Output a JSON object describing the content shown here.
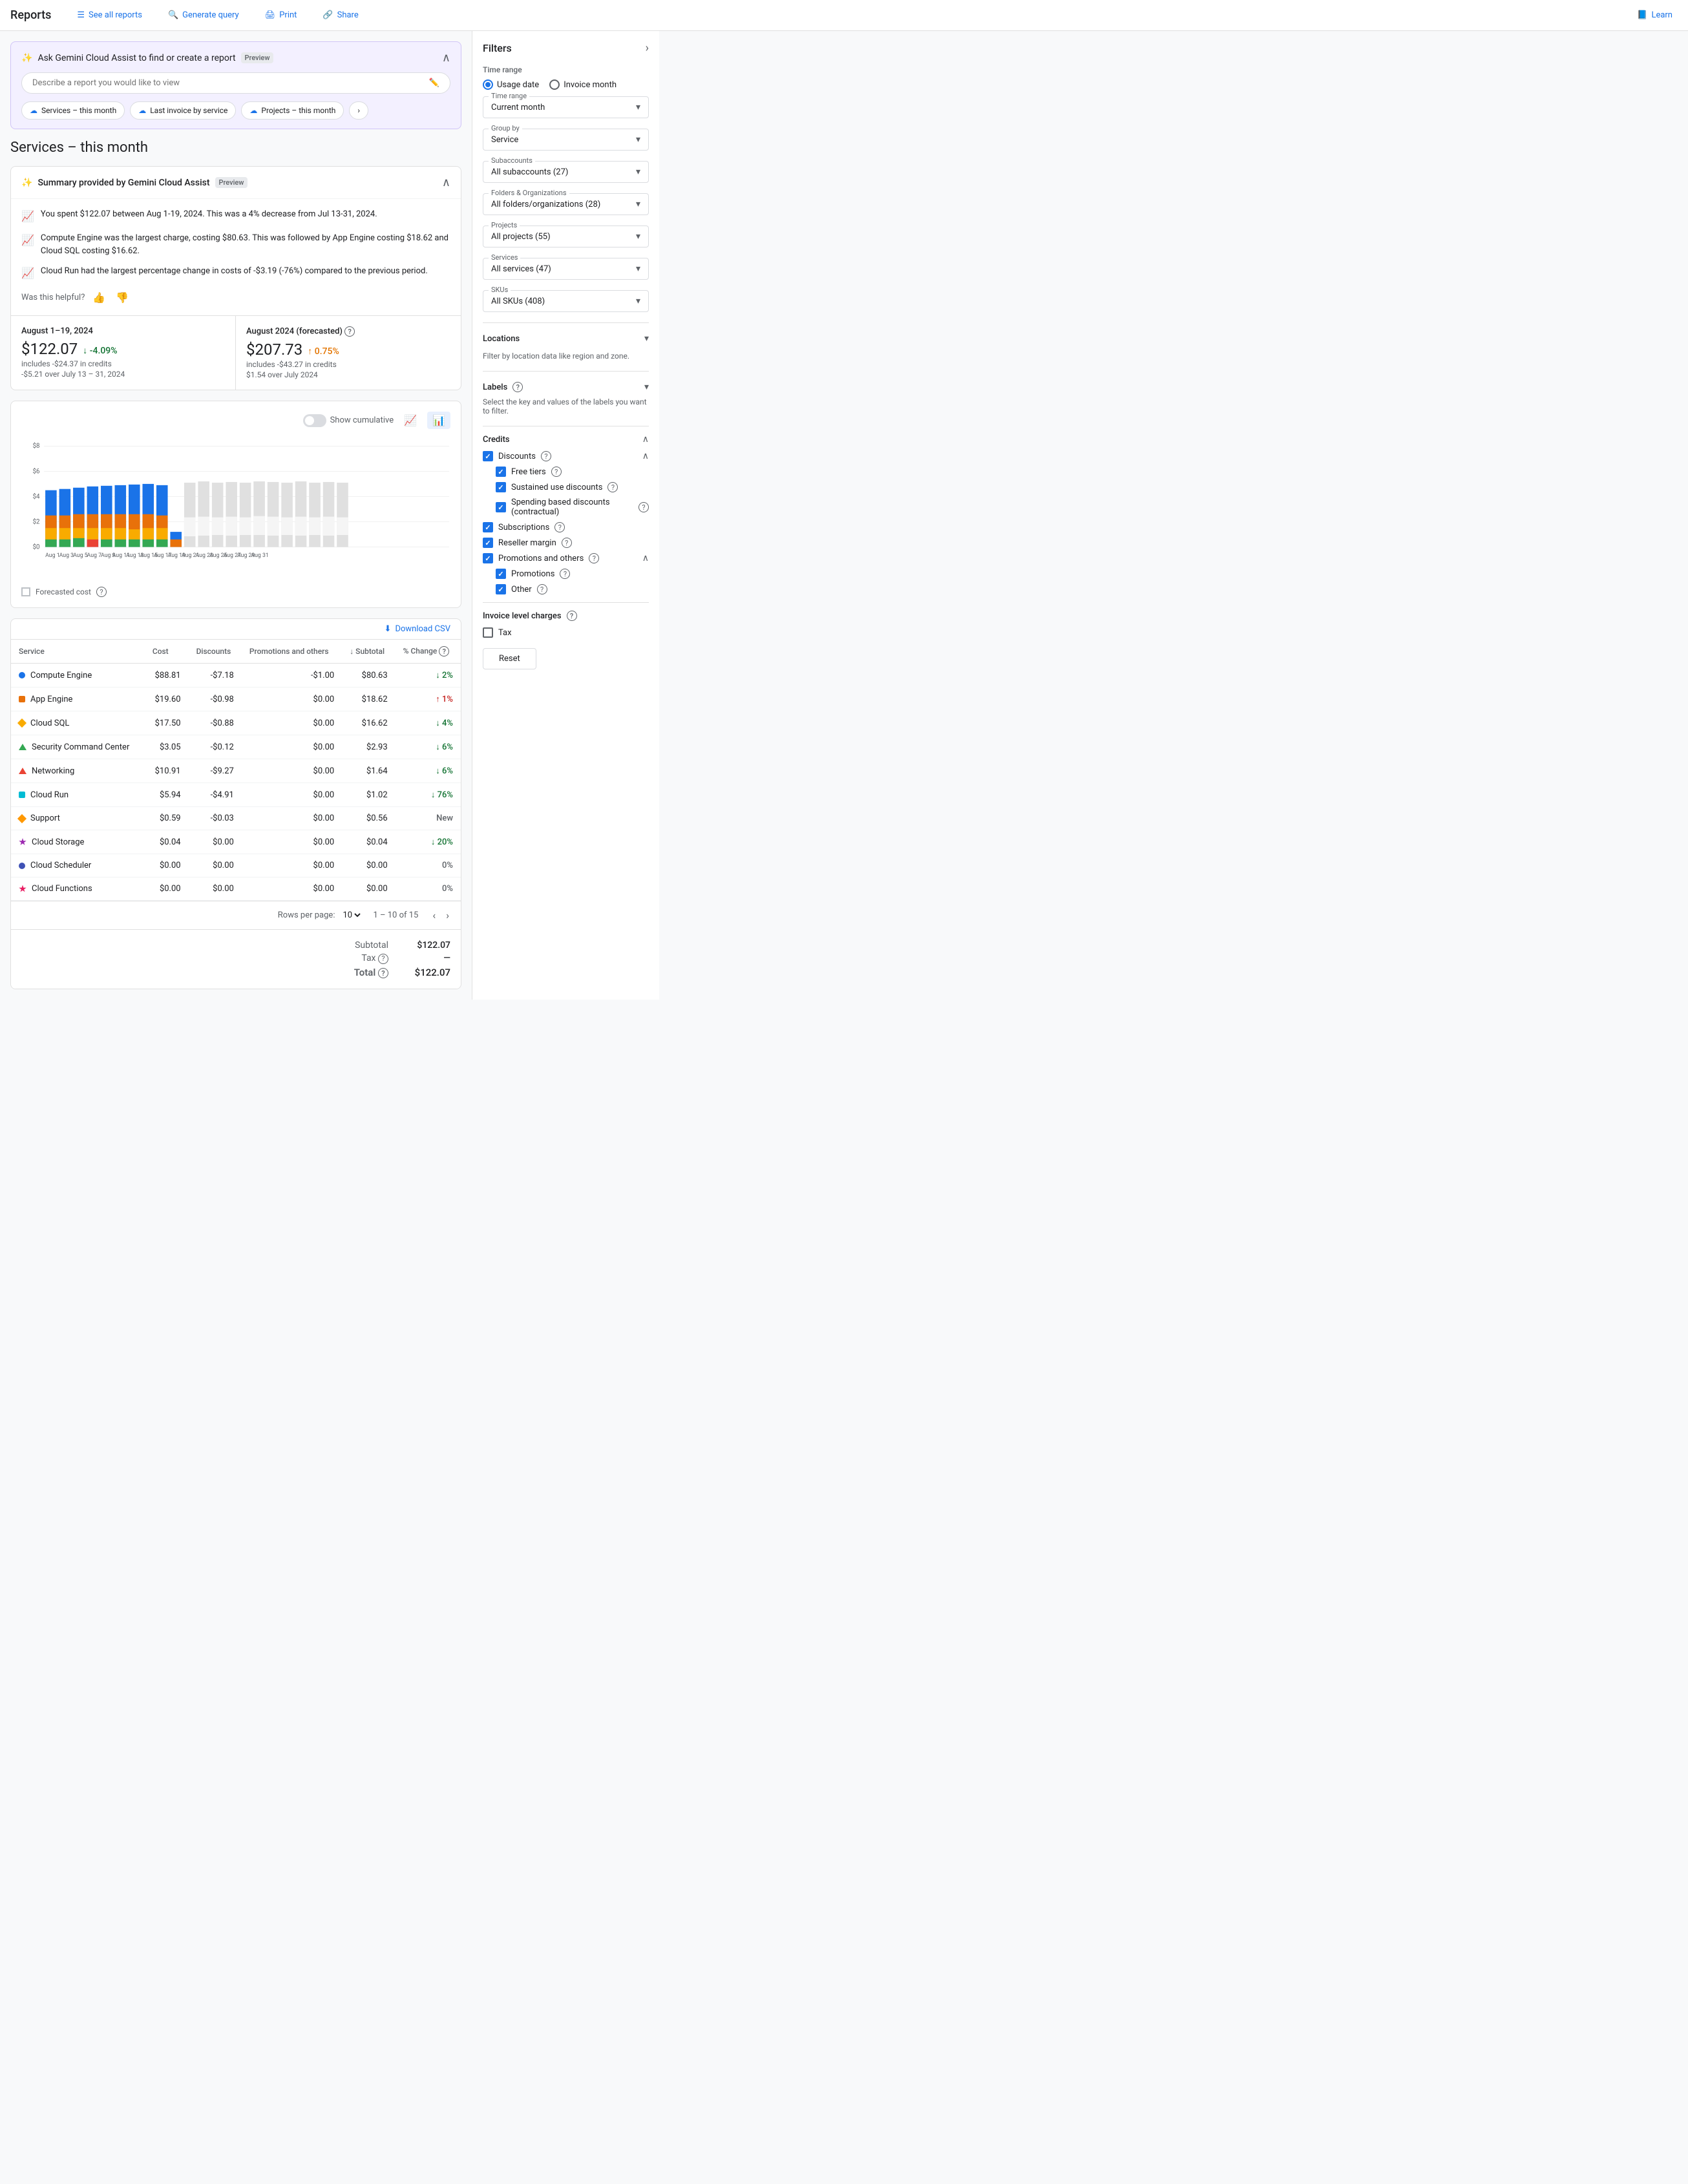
{
  "nav": {
    "title": "Reports",
    "items": [
      {
        "label": "See all reports",
        "icon": "☰"
      },
      {
        "label": "Generate query",
        "icon": "🔍"
      },
      {
        "label": "Print",
        "icon": "🖨"
      },
      {
        "label": "Share",
        "icon": "🔗"
      },
      {
        "label": "Learn",
        "icon": "📘"
      }
    ]
  },
  "gemini": {
    "title": "Ask Gemini Cloud Assist to find or create a report",
    "badge": "Preview",
    "placeholder": "Describe a report you would like to view",
    "chips": [
      {
        "label": "Services – this month"
      },
      {
        "label": "Last invoice by service"
      },
      {
        "label": "Projects – this month"
      }
    ]
  },
  "page_title": "Services – this month",
  "summary": {
    "title": "Summary provided by Gemini Cloud Assist",
    "badge": "Preview",
    "items": [
      {
        "text": "You spent $122.07 between Aug 1-19, 2024. This was a 4% decrease from Jul 13-31, 2024."
      },
      {
        "text": "Compute Engine was the largest charge, costing $80.63. This was followed by App Engine costing $18.62 and Cloud SQL costing $16.62."
      },
      {
        "text": "Cloud Run had the largest percentage change in costs of -$3.19 (-76%) compared to the previous period."
      }
    ],
    "helpful_label": "Was this helpful?"
  },
  "metrics": {
    "current": {
      "label": "August 1–19, 2024",
      "value": "$122.07",
      "sub": "includes -$24.37 in credits",
      "change": "↓ -4.09%",
      "change_sub": "-$5.21 over July 13 – 31, 2024",
      "type": "down"
    },
    "forecast": {
      "label": "August 2024 (forecasted)",
      "value": "$207.73",
      "sub": "includes -$43.27 in credits",
      "change": "↑ 0.75%",
      "change_sub": "$1.54 over July 2024",
      "type": "up"
    }
  },
  "chart": {
    "show_cumulative_label": "Show cumulative",
    "y_labels": [
      "$8",
      "$6",
      "$4",
      "$2",
      "$0"
    ],
    "x_labels": [
      "Aug 1",
      "Aug 3",
      "Aug 5",
      "Aug 7",
      "Aug 9",
      "Aug 11",
      "Aug 13",
      "Aug 15",
      "Aug 17",
      "Aug 19",
      "Aug 21",
      "Aug 23",
      "Aug 25",
      "Aug 27",
      "Aug 29",
      "Aug 31"
    ],
    "forecasted_legend": "Forecasted cost"
  },
  "table": {
    "download_label": "Download CSV",
    "columns": [
      "Service",
      "Cost",
      "Discounts",
      "Promotions and others",
      "Subtotal",
      "% Change"
    ],
    "rows": [
      {
        "service": "Compute Engine",
        "color": "#1a73e8",
        "shape": "circle",
        "cost": "$88.81",
        "discounts": "-$7.18",
        "promotions": "-$1.00",
        "subtotal": "$80.63",
        "change": "↓ 2%",
        "change_type": "down"
      },
      {
        "service": "App Engine",
        "color": "#e8710a",
        "shape": "square",
        "cost": "$19.60",
        "discounts": "-$0.98",
        "promotions": "$0.00",
        "subtotal": "$18.62",
        "change": "↑ 1%",
        "change_type": "up"
      },
      {
        "service": "Cloud SQL",
        "color": "#f9ab00",
        "shape": "diamond",
        "cost": "$17.50",
        "discounts": "-$0.88",
        "promotions": "$0.00",
        "subtotal": "$16.62",
        "change": "↓ 4%",
        "change_type": "down"
      },
      {
        "service": "Security Command Center",
        "color": "#34a853",
        "shape": "triangle",
        "cost": "$3.05",
        "discounts": "-$0.12",
        "promotions": "$0.00",
        "subtotal": "$2.93",
        "change": "↓ 6%",
        "change_type": "down"
      },
      {
        "service": "Networking",
        "color": "#ea4335",
        "shape": "triangle",
        "cost": "$10.91",
        "discounts": "-$9.27",
        "promotions": "$0.00",
        "subtotal": "$1.64",
        "change": "↓ 6%",
        "change_type": "down"
      },
      {
        "service": "Cloud Run",
        "color": "#00bcd4",
        "shape": "square",
        "cost": "$5.94",
        "discounts": "-$4.91",
        "promotions": "$0.00",
        "subtotal": "$1.02",
        "change": "↓ 76%",
        "change_type": "down"
      },
      {
        "service": "Support",
        "color": "#ff9800",
        "shape": "diamond",
        "cost": "$0.59",
        "discounts": "-$0.03",
        "promotions": "$0.00",
        "subtotal": "$0.56",
        "change": "New",
        "change_type": "new"
      },
      {
        "service": "Cloud Storage",
        "color": "#9c27b0",
        "shape": "star",
        "cost": "$0.04",
        "discounts": "$0.00",
        "promotions": "$0.00",
        "subtotal": "$0.04",
        "change": "↓ 20%",
        "change_type": "down"
      },
      {
        "service": "Cloud Scheduler",
        "color": "#3f51b5",
        "shape": "circle",
        "cost": "$0.00",
        "discounts": "$0.00",
        "promotions": "$0.00",
        "subtotal": "$0.00",
        "change": "0%",
        "change_type": "zero"
      },
      {
        "service": "Cloud Functions",
        "color": "#e91e63",
        "shape": "star",
        "cost": "$0.00",
        "discounts": "$0.00",
        "promotions": "$0.00",
        "subtotal": "$0.00",
        "change": "0%",
        "change_type": "zero"
      }
    ],
    "pagination": {
      "rows_per_page": "10",
      "range": "1 – 10 of 15"
    },
    "totals": {
      "subtotal_label": "Subtotal",
      "subtotal_value": "$122.07",
      "tax_label": "Tax",
      "tax_value": "—",
      "total_label": "Total",
      "total_value": "$122.07"
    }
  },
  "filters": {
    "title": "Filters",
    "time_range_label": "Time range",
    "usage_date_label": "Usage date",
    "invoice_month_label": "Invoice month",
    "current_month_label": "Current month",
    "group_by_label": "Group by",
    "group_by_value": "Service",
    "subaccounts_label": "Subaccounts",
    "subaccounts_value": "All subaccounts (27)",
    "folders_label": "Folders & Organizations",
    "folders_value": "All folders/organizations (28)",
    "projects_label": "Projects",
    "projects_value": "All projects (55)",
    "services_label": "Services",
    "services_value": "All services (47)",
    "skus_label": "SKUs",
    "skus_value": "All SKUs (408)",
    "locations_label": "Locations",
    "locations_sub": "Filter by location data like region and zone.",
    "labels_label": "Labels",
    "labels_sub": "Select the key and values of the labels you want to filter.",
    "credits_label": "Credits",
    "discounts_label": "Discounts",
    "free_tiers_label": "Free tiers",
    "sustained_label": "Sustained use discounts",
    "spending_label": "Spending based discounts (contractual)",
    "subscriptions_label": "Subscriptions",
    "reseller_label": "Reseller margin",
    "promotions_others_label": "Promotions and others",
    "promotions_label": "Promotions",
    "other_label": "Other",
    "invoice_level_label": "Invoice level charges",
    "tax_label": "Tax",
    "reset_label": "Reset"
  }
}
